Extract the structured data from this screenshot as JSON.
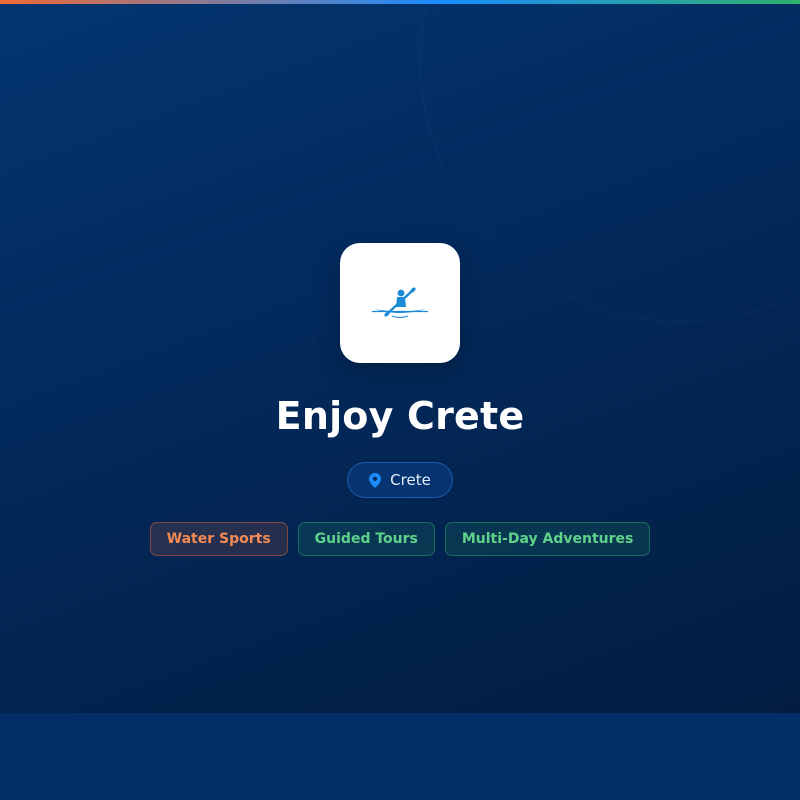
{
  "header": {
    "title": "Enjoy Crete",
    "location": "Crete",
    "logo_icon": "kayak-icon",
    "location_icon": "map-pin-icon"
  },
  "tags": [
    {
      "label": "Water Sports",
      "color": "#f38a55"
    },
    {
      "label": "Guided Tours",
      "color": "#5fd28a"
    },
    {
      "label": "Multi-Day Adventures",
      "color": "#5fd28a"
    }
  ],
  "colors": {
    "background": "#032a5c",
    "accent_orange": "#f06a35",
    "accent_blue": "#1a8cff",
    "accent_green": "#2fb06d",
    "logo_blue": "#1a8ad6"
  }
}
